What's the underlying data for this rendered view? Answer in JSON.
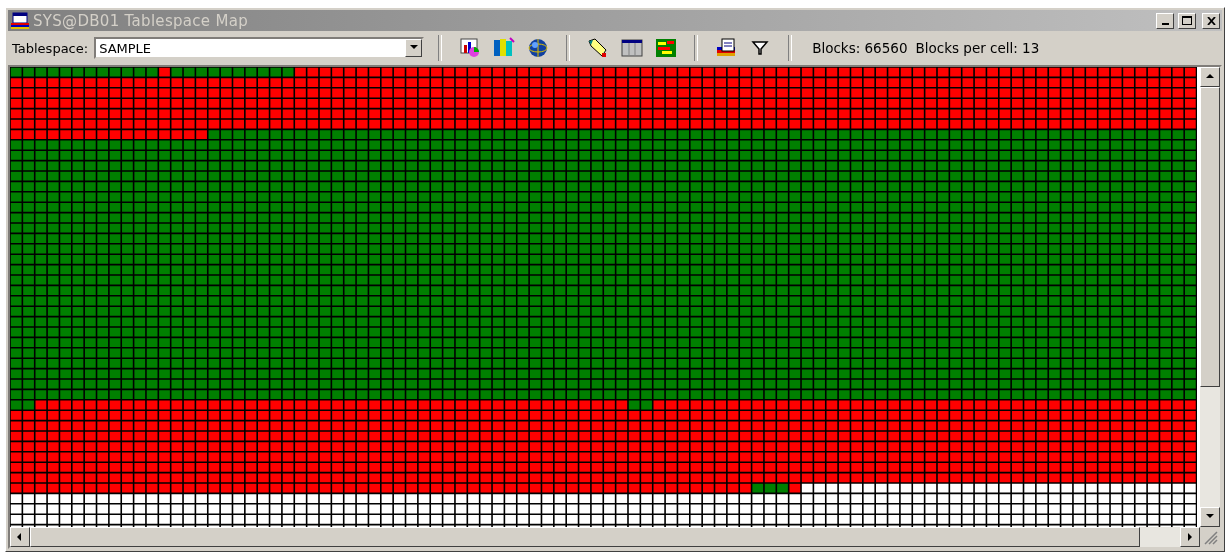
{
  "window": {
    "title": "SYS@DB01 Tablespace Map",
    "active": false
  },
  "toolbar": {
    "label": "Tablespace:",
    "tablespace": "SAMPLE",
    "info": [
      {
        "text": "Blocks: 66560"
      },
      {
        "text": "Blocks per cell: 13"
      }
    ]
  }
}
